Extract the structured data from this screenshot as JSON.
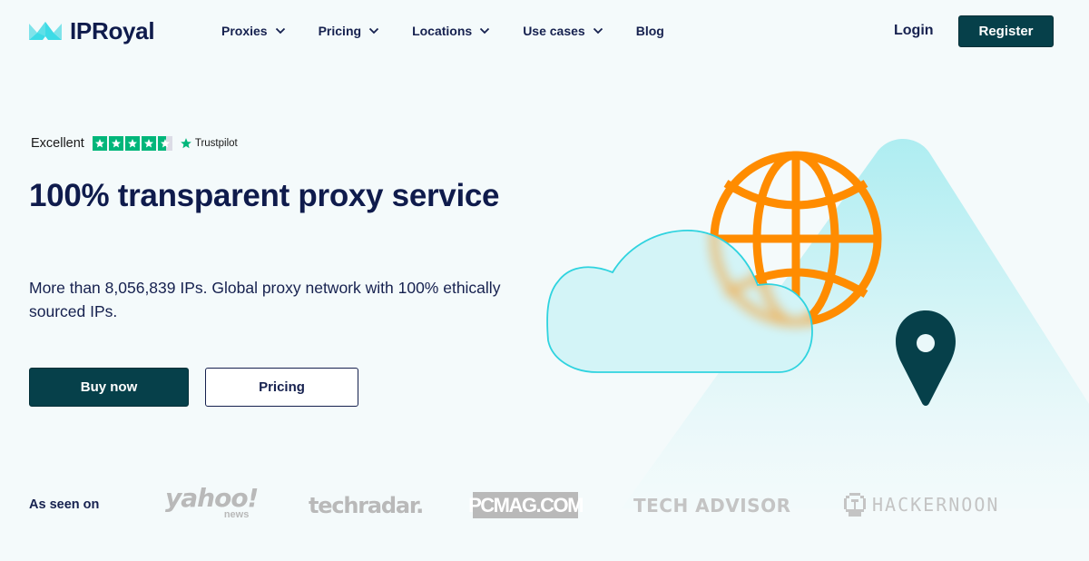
{
  "header": {
    "brand": "IPRoyal",
    "nav": [
      {
        "label": "Proxies",
        "has_dropdown": true
      },
      {
        "label": "Pricing",
        "has_dropdown": true
      },
      {
        "label": "Locations",
        "has_dropdown": true
      },
      {
        "label": "Use cases",
        "has_dropdown": true
      },
      {
        "label": "Blog",
        "has_dropdown": false
      }
    ],
    "login_label": "Login",
    "register_label": "Register"
  },
  "trustpilot": {
    "rating_text": "Excellent",
    "stars": 4.5,
    "brand": "Trustpilot"
  },
  "hero": {
    "title": "100% transparent proxy service",
    "subtitle": "More than 8,056,839 IPs. Global proxy network with 100% ethically sourced IPs.",
    "buy_label": "Buy now",
    "pricing_label": "Pricing"
  },
  "illustration": {
    "icons": [
      "globe-icon",
      "cloud-icon",
      "location-pin-icon"
    ]
  },
  "press": {
    "label": "As seen on",
    "outlets": [
      {
        "name": "yahoo!",
        "sub": "news"
      },
      {
        "name": "techradar."
      },
      {
        "name": "PCMAG.COM"
      },
      {
        "name": "TECH ADVISOR"
      },
      {
        "name": "HACKERNOON"
      }
    ]
  },
  "colors": {
    "brand_dark": "#06404a",
    "text_navy": "#0f1b4c",
    "accent_cyan": "#3ddbe6",
    "globe_orange": "#ff8c00",
    "trustpilot_green": "#00b67a",
    "background": "#f4fafb"
  }
}
